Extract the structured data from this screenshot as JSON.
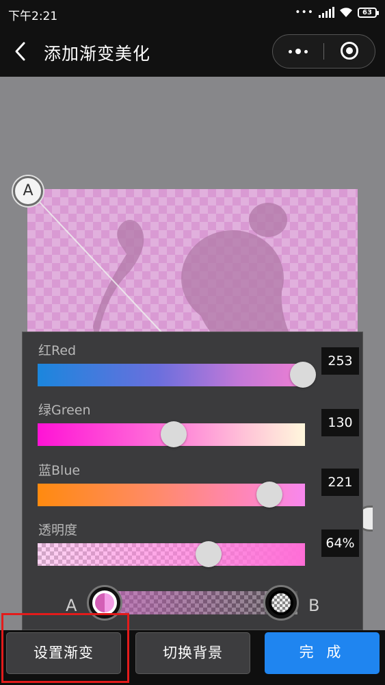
{
  "status_bar": {
    "time": "下午2:21",
    "battery": "63",
    "icons": [
      "dots-icon",
      "signal-icon",
      "wifi-icon",
      "battery-icon"
    ]
  },
  "nav": {
    "title": "添加渐变美化",
    "back_icon": "chevron-left-icon",
    "more_icon": "more-dots-icon",
    "close_icon": "target-close-icon"
  },
  "canvas": {
    "handle_a_label": "A",
    "background_color": "#87878a"
  },
  "color_panel": {
    "red": {
      "label": "红Red",
      "value": "253",
      "level": 253,
      "max": 255
    },
    "green": {
      "label": "绿Green",
      "value": "130",
      "level": 130,
      "max": 255
    },
    "blue": {
      "label": "蓝Blue",
      "value": "221",
      "level": 221,
      "max": 255
    },
    "alpha": {
      "label": "透明度",
      "value": "64%",
      "level": 0.64
    },
    "stop_a_label": "A",
    "stop_b_label": "B"
  },
  "bottom_bar": {
    "set_gradient": "设置渐变",
    "switch_background": "切换背景",
    "done": "完 成"
  },
  "colors": {
    "accent_blue": "#1f85f0",
    "highlight_red": "#e31b1b"
  }
}
